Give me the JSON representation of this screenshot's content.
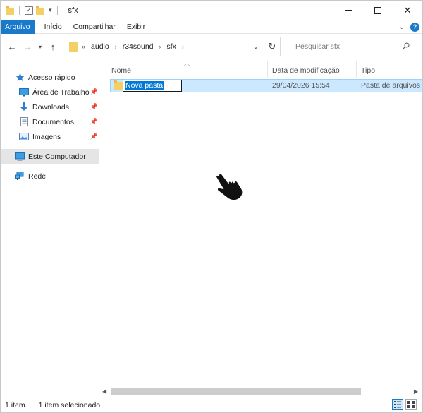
{
  "window": {
    "title": "sfx",
    "minimize_label": "—",
    "close_label": "✕"
  },
  "ribbon": {
    "tabs": [
      {
        "label": "Arquivo"
      },
      {
        "label": "Início"
      },
      {
        "label": "Compartilhar"
      },
      {
        "label": "Exibir"
      }
    ],
    "help_label": "?"
  },
  "address": {
    "overflow": "«",
    "crumbs": [
      "audio",
      "r34sound",
      "sfx"
    ],
    "separator": "›"
  },
  "search": {
    "placeholder": "Pesquisar sfx"
  },
  "nav": {
    "items": [
      {
        "label": "Acesso rápido",
        "icon": "star-icon",
        "pinned": false
      },
      {
        "label": "Área de Trabalho",
        "icon": "desktop-icon",
        "pinned": true
      },
      {
        "label": "Downloads",
        "icon": "download-arrow-icon",
        "pinned": true
      },
      {
        "label": "Documentos",
        "icon": "document-icon",
        "pinned": true
      },
      {
        "label": "Imagens",
        "icon": "image-icon",
        "pinned": true
      },
      {
        "label": "Este Computador",
        "icon": "computer-icon",
        "selected": true
      },
      {
        "label": "Rede",
        "icon": "network-icon"
      }
    ]
  },
  "columns": {
    "name": "Nome",
    "modified": "Data de modificação",
    "type": "Tipo"
  },
  "files": [
    {
      "name": "Nova pasta",
      "modified": "29/04/2026 15:54",
      "type": "Pasta de arquivos",
      "icon": "folder-icon",
      "renaming": true,
      "selected": true
    }
  ],
  "status": {
    "count": "1 item",
    "selected": "1 item selecionado"
  },
  "colors": {
    "accent": "#1979ca",
    "selection": "#cce8ff",
    "folder": "#f4cf63"
  }
}
